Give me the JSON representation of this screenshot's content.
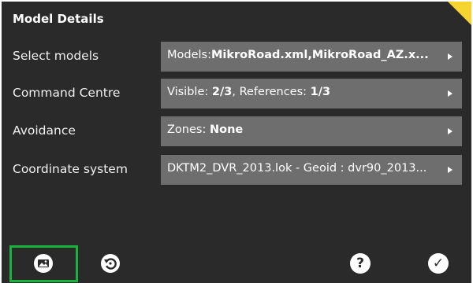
{
  "panel": {
    "title": "Model Details"
  },
  "rows": [
    {
      "label": "Select models",
      "prefix": "Models:",
      "value": "MikroRoad.xml,MikroRoad_AZ.x...",
      "suffix": ""
    },
    {
      "label": "Command Centre",
      "prefix": "Visible: ",
      "value": "2/3",
      "mid": ", References: ",
      "value2": "1/3"
    },
    {
      "label": "Avoidance",
      "prefix": "Zones: ",
      "value": "None"
    },
    {
      "label": "Coordinate system",
      "text": "DKTM2_DVR_2013.lok - Geoid : dvr90_2013..."
    }
  ],
  "toolbar": {
    "left_icon": "map-image-icon",
    "undo_icon": "rotate-undo-icon",
    "help_icon": "help-icon",
    "help_glyph": "?",
    "confirm_icon": "checkmark-icon",
    "confirm_glyph": "✓"
  },
  "colors": {
    "background": "#2a2a2a",
    "field": "#6e6e6e",
    "accent_corner": "#f6d531",
    "highlight": "#17b33a"
  }
}
